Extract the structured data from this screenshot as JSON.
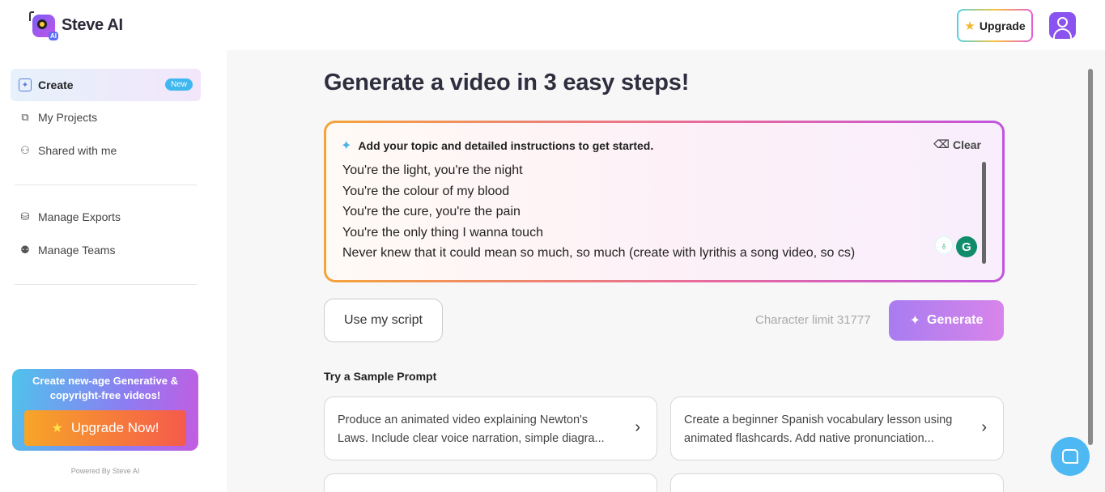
{
  "app": {
    "name": "Steve AI",
    "logo_badge": "AI"
  },
  "header": {
    "upgrade_label": "Upgrade"
  },
  "sidebar": {
    "items": [
      {
        "label": "Create",
        "badge": "New",
        "icon": "create-sparkle-icon"
      },
      {
        "label": "My Projects",
        "icon": "projects-icon"
      },
      {
        "label": "Shared with me",
        "icon": "shared-user-icon"
      },
      {
        "label": "Manage Exports",
        "icon": "exports-icon"
      },
      {
        "label": "Manage Teams",
        "icon": "teams-icon"
      }
    ],
    "promo": {
      "text": "Create new-age Generative & copyright-free videos!",
      "button": "Upgrade Now!"
    },
    "powered_by": "Powered By Steve AI"
  },
  "main": {
    "title": "Generate a video in 3 easy steps!",
    "prompt": {
      "heading": "Add your topic and detailed instructions to get started.",
      "clear_label": "Clear",
      "lines": [
        "You're the light, you're the night",
        "You're the colour of my blood",
        "You're the cure, you're the pain",
        "You're the only thing I wanna touch",
        "Never knew that it could mean so much, so much (create with lyrithis a song video, so cs)"
      ]
    },
    "use_script_label": "Use my script",
    "char_limit": "Character limit 31777",
    "generate_label": "Generate",
    "sample_title": "Try a Sample Prompt",
    "samples": [
      "Produce an animated video explaining Newton's Laws. Include clear voice narration, simple diagra...",
      "Create a beginner Spanish vocabulary lesson using animated flashcards. Add native pronunciation...",
      "",
      ""
    ]
  },
  "colors": {
    "accent": "#8a52ef",
    "generate": "#b982ee",
    "new_badge": "#3fb7ef"
  }
}
